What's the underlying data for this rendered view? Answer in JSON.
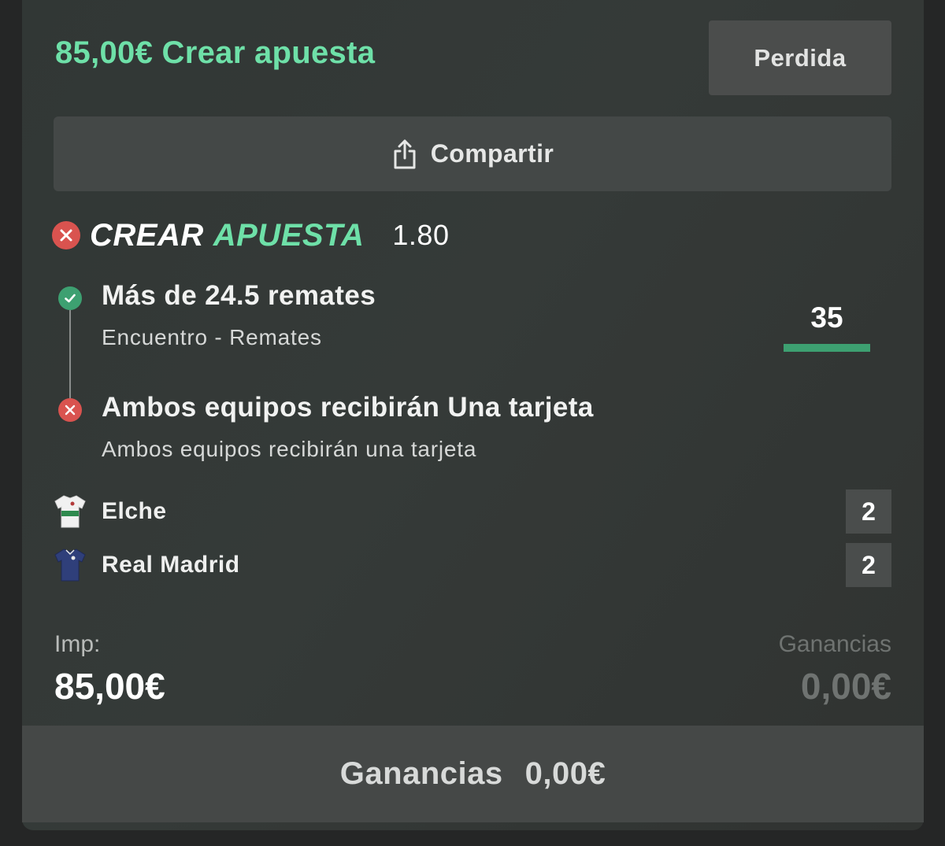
{
  "header": {
    "title": "85,00€ Crear apuesta",
    "status_label": "Perdida"
  },
  "share": {
    "label": "Compartir",
    "icon": "share-icon"
  },
  "bet": {
    "brand_white": "CREAR",
    "brand_green": "APUESTA",
    "odds": "1.80",
    "status_icon": "cross-icon"
  },
  "selections": [
    {
      "title": "Más de 24.5 remates",
      "subtitle": "Encuentro - Remates",
      "result": "won",
      "stat_value": "35",
      "stat_progress": 1.0
    },
    {
      "title": "Ambos equipos recibirán Una tarjeta",
      "subtitle": "Ambos equipos recibirán una tarjeta",
      "result": "lost"
    }
  ],
  "teams": [
    {
      "name": "Elche",
      "count": "2",
      "icon": "jersey-icon"
    },
    {
      "name": "Real Madrid",
      "count": "2",
      "icon": "jersey-icon"
    }
  ],
  "summary": {
    "stake_label": "Imp:",
    "stake_value": "85,00€",
    "winnings_label": "Ganancias",
    "winnings_value": "0,00€"
  },
  "footer": {
    "label": "Ganancias",
    "value": "0,00€"
  },
  "colors": {
    "accent_green": "#6ee0a8",
    "success_green": "#3da071",
    "error_red": "#d9534f"
  }
}
